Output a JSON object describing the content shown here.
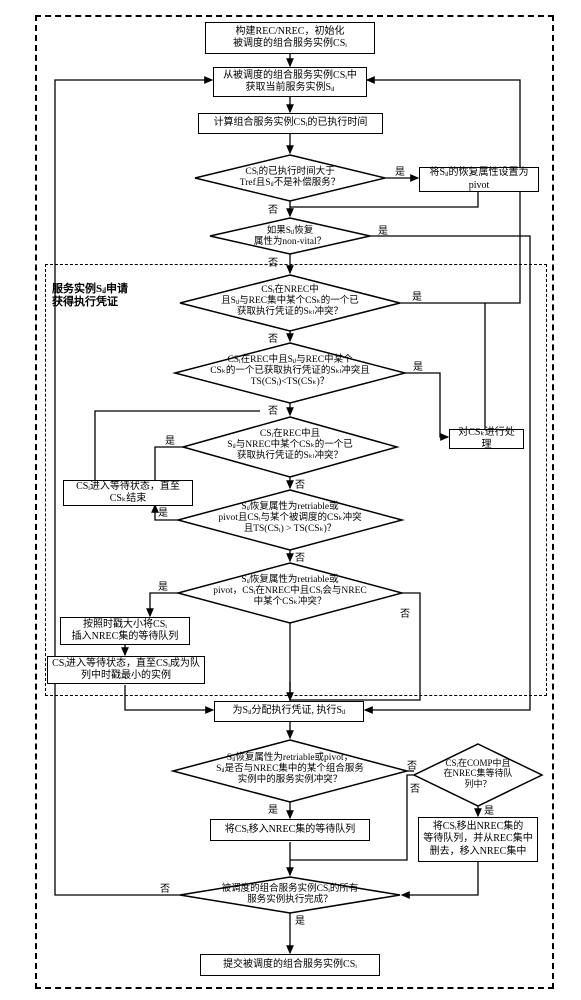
{
  "chart_data": {
    "type": "flowchart",
    "nodes": {
      "b1": "构建REC/NREC，初始化\n被调度的组合服务实例CSᵢ",
      "b2": "从被调度的组合服务实例CSᵢ中\n获取当前服务实例Sᵢⱼ",
      "b3": "计算组合服务实例CSᵢ的已执行时间",
      "d1": "CSᵢ的已执行时间大于\nTref且Sᵢⱼ不是补偿服务？",
      "b4": "将Sᵢⱼ的恢复属性设置为pivot",
      "d2": "如果Sᵢⱼ恢复\n属性为non-vital？",
      "d3": "CSᵢ在NREC中\n且Sᵢⱼ与REC集中某个CSₖ的一个已\n获取执行凭证的Sₖₗ冲突？",
      "d4": "CSᵢ在REC中且Sᵢⱼ与REC中某个\nCSₖ的一个已获取执行凭证的Sₖₗ冲突且\nTS(CSᵢ)<TS(CSₖ)？",
      "d5": "CSᵢ在REC中且\nSᵢⱼ与NREC中某个CSₖ的一个已\n获取执行凭证的Sₖₗ冲突？",
      "b5": "对CSₖ进行处理",
      "d6": "Sᵢⱼ恢复属性为retriable或\npivot且CSᵢ与某个被调度的CSₖ冲突\n且TS(CSᵢ) > TS(CSₖ)？",
      "b6": "CSᵢ进入等待状态，直至\nCSₖ结束",
      "d7": "Sᵢⱼ恢复属性为retriable或\npivot，CSᵢ在NREC中且CSᵢ会与NREC\n中某个CSₖ冲突？",
      "b7": "按照时戳大小将CSᵢ\n插入NREC集的等待队列",
      "b8": "CSᵢ进入等待状态，直至CSᵢ成为队\n列中时戳最小的实例",
      "b9": "为Sᵢⱼ分配执行凭证, 执行Sᵢⱼ",
      "d8": "Sᵢⱼ恢复属性为retriable或pivot，\nSᵢⱼ是否与NREC集中的某个组合服务\n实例中的服务实例冲突？",
      "b10": "将CSᵢ移入NREC集的等待队列",
      "d9": "CSᵢ在COMP中且\n在NREC集等待队\n列中？",
      "b11": "将CSᵢ移出NREC集的\n等待队列，并从REC集中\n删去，移入NREC集中",
      "d10": "被调度的组合服务实例CSᵢ的所有\n服务实例执行完成？",
      "b12": "提交被调度的组合服务实例CSᵢ"
    },
    "section_label": "服务实例Sᵢⱼ申请\n获得执行凭证",
    "labels": {
      "yes": "是",
      "no": "否"
    }
  }
}
